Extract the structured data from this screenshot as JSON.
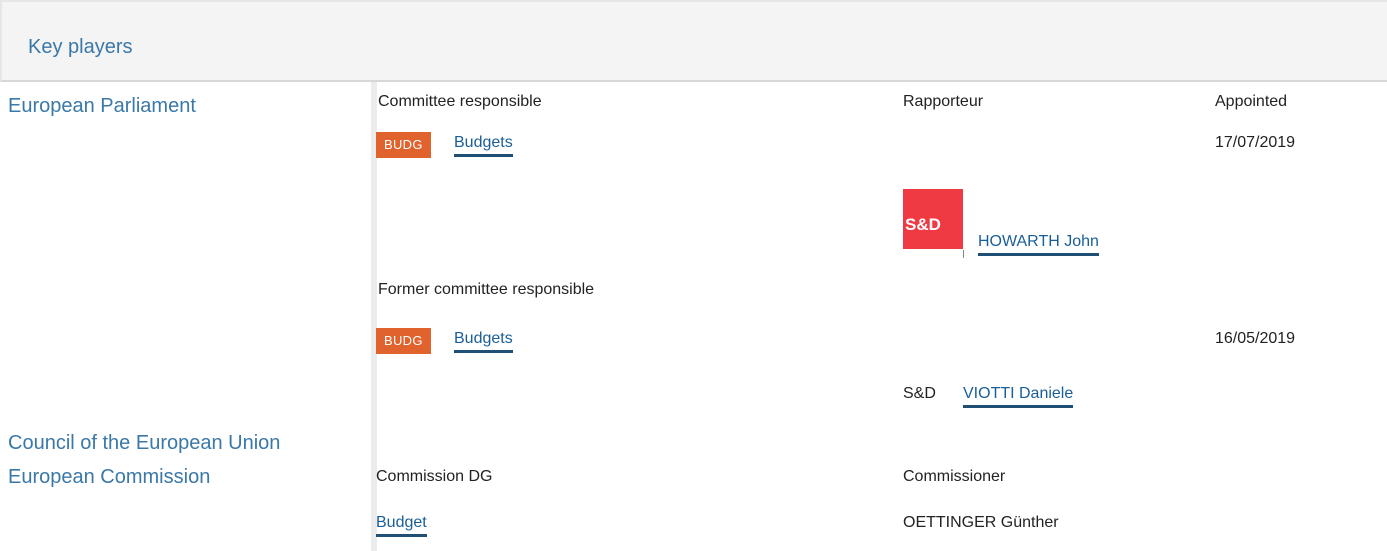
{
  "header": {
    "title": "Key players"
  },
  "institutions": {
    "parliament": "European Parliament",
    "council": "Council of the European Union",
    "commission": "European Commission"
  },
  "parliament": {
    "committee_label": "Committee responsible",
    "rapporteur_label": "Rapporteur",
    "appointed_label": "Appointed",
    "current": {
      "badge": "BUDG",
      "committee": "Budgets",
      "date": "17/07/2019",
      "rapporteur_group_logo": "S&D",
      "rapporteur": "HOWARTH John"
    },
    "former_label": "Former committee responsible",
    "former": {
      "badge": "BUDG",
      "committee": "Budgets",
      "date": "16/05/2019",
      "rapporteur_group": "S&D",
      "rapporteur": "VIOTTI Daniele"
    }
  },
  "commission": {
    "dg_label": "Commission DG",
    "commissioner_label": "Commissioner",
    "dg": "Budget",
    "commissioner": "OETTINGER Günther"
  },
  "colors": {
    "badge": "#e0622d",
    "link": "#1a5e97",
    "institution_text": "#3a78a8",
    "sd_logo": "#ef3a44"
  }
}
